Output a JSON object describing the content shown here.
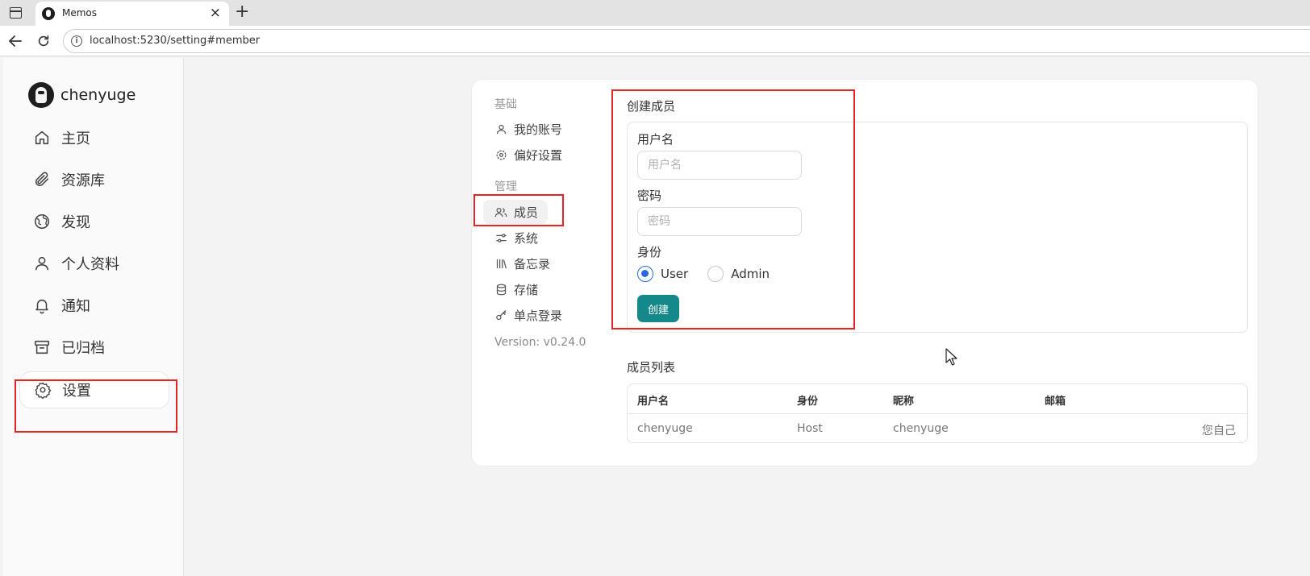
{
  "browser": {
    "tab_title": "Memos",
    "tab_close": "×",
    "new_tab": "+",
    "url": "localhost:5230/setting#member"
  },
  "sidebar": {
    "username": "chenyuge",
    "items": [
      {
        "label": "主页",
        "icon": "home-icon"
      },
      {
        "label": "资源库",
        "icon": "paperclip-icon"
      },
      {
        "label": "发现",
        "icon": "globe-icon"
      },
      {
        "label": "个人资料",
        "icon": "user-icon"
      },
      {
        "label": "通知",
        "icon": "bell-icon"
      },
      {
        "label": "已归档",
        "icon": "archive-icon"
      },
      {
        "label": "设置",
        "icon": "gear-icon",
        "active": true
      }
    ]
  },
  "settings_nav": {
    "group_basic": "基础",
    "group_admin": "管理",
    "items": [
      {
        "label": "我的账号",
        "icon": "user-icon"
      },
      {
        "label": "偏好设置",
        "icon": "gear-icon"
      },
      {
        "label": "成员",
        "icon": "users-icon",
        "active": true
      },
      {
        "label": "系统",
        "icon": "sliders-icon"
      },
      {
        "label": "备忘录",
        "icon": "library-icon"
      },
      {
        "label": "存储",
        "icon": "database-icon"
      },
      {
        "label": "单点登录",
        "icon": "key-icon"
      }
    ],
    "version": "Version: v0.24.0"
  },
  "create_member": {
    "title": "创建成员",
    "username_label": "用户名",
    "username_placeholder": "用户名",
    "password_label": "密码",
    "password_placeholder": "密码",
    "role_label": "身份",
    "role_options": [
      "User",
      "Admin"
    ],
    "role_selected": "User",
    "submit_label": "创建"
  },
  "member_list": {
    "title": "成员列表",
    "columns": [
      "用户名",
      "身份",
      "昵称",
      "邮箱"
    ],
    "rows": [
      {
        "username": "chenyuge",
        "role": "Host",
        "nickname": "chenyuge",
        "email": "",
        "action": "您自己"
      }
    ]
  },
  "colors": {
    "accent": "#15898a",
    "highlight_box": "#e52525",
    "radio_selected": "#2a6ad8"
  }
}
